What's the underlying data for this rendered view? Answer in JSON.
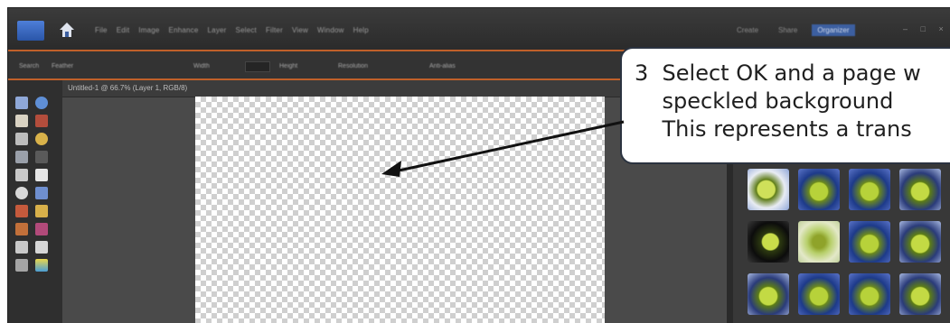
{
  "menubar": {
    "items": [
      "File",
      "Edit",
      "Image",
      "Enhance",
      "Layer",
      "Select",
      "Filter",
      "View",
      "Window",
      "Help"
    ],
    "right_buttons": [
      "Create",
      "Share",
      "Organizer"
    ],
    "window_controls": "– □ ×"
  },
  "options_bar": {
    "labels": [
      "Search",
      "Feather",
      "Width",
      "Height",
      "Resolution",
      "Anti-alias"
    ]
  },
  "document": {
    "tab_label": "Untitled-1 @ 66.7% (Layer 1, RGB/8)"
  },
  "callout": {
    "line1": "3  Select OK and a page w",
    "line2": "    speckled background",
    "line3": "    This represents a trans"
  },
  "colors": {
    "accent_orange": "#c0602a",
    "organizer_blue": "#3c5fa0",
    "callout_border": "#2b3340"
  }
}
